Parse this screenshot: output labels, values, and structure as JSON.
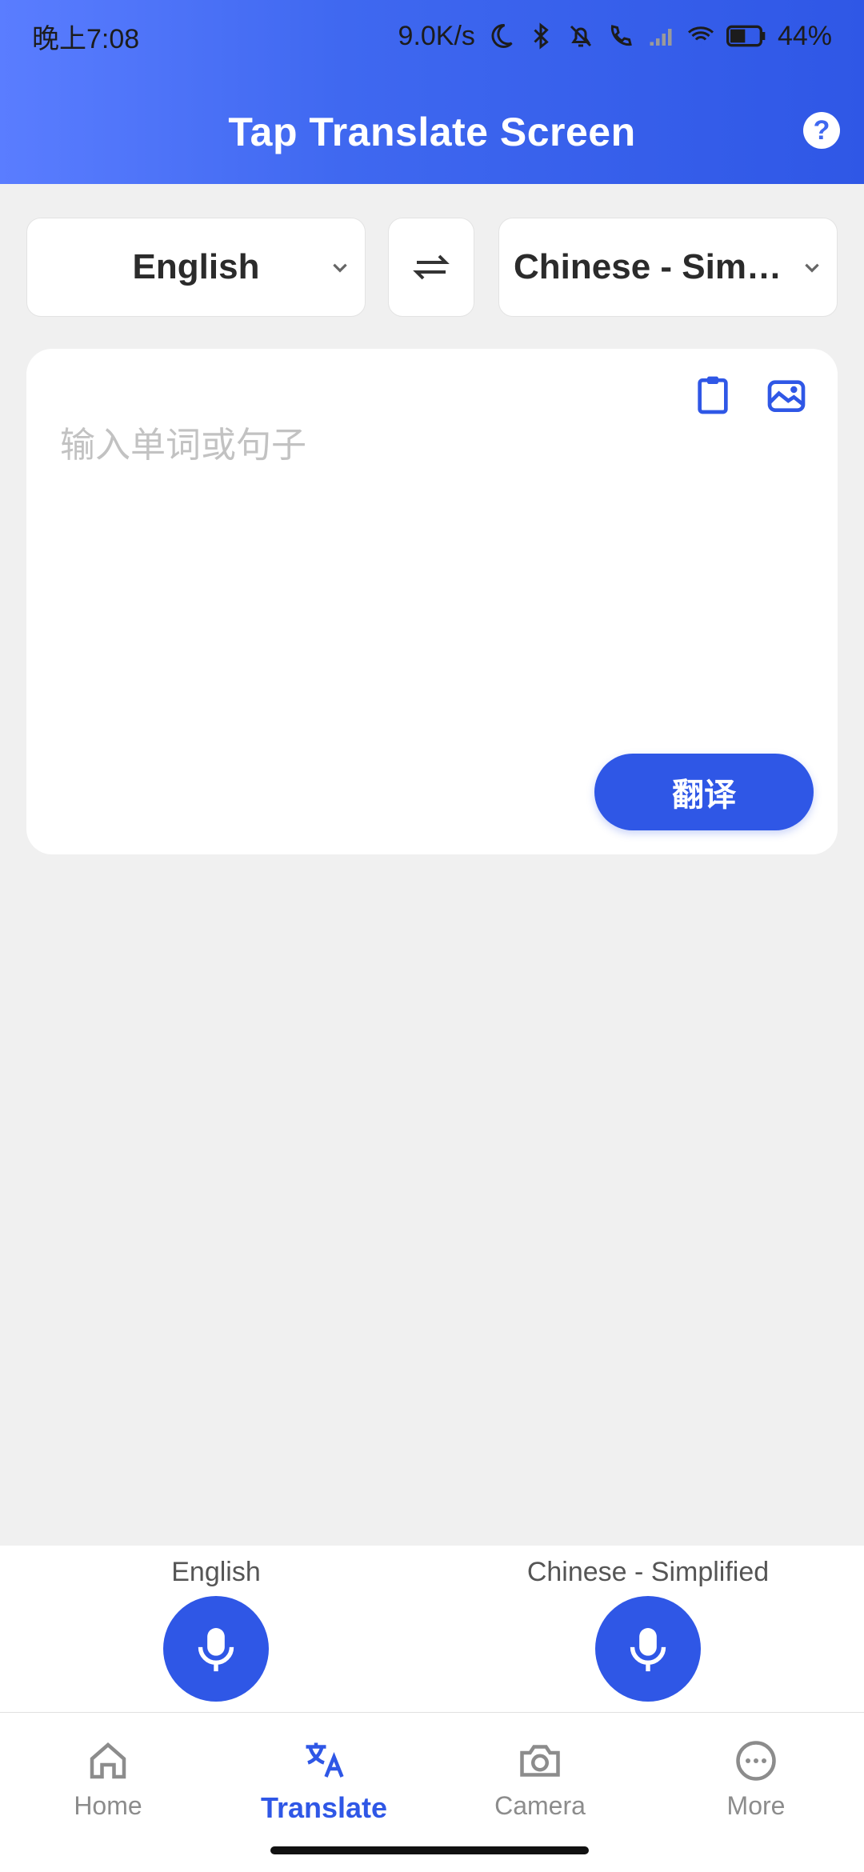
{
  "status_bar": {
    "time": "晚上7:08",
    "network_speed": "9.0K/s",
    "battery": "44%"
  },
  "header": {
    "title": "Tap Translate Screen",
    "help_symbol": "?"
  },
  "languages": {
    "source": "English",
    "target": "Chinese - Simpl..."
  },
  "input": {
    "placeholder": "输入单词或句子",
    "translate_label": "翻译"
  },
  "voice": {
    "left_label": "English",
    "right_label": "Chinese - Simplified"
  },
  "nav": {
    "items": [
      {
        "label": "Home"
      },
      {
        "label": "Translate"
      },
      {
        "label": "Camera"
      },
      {
        "label": "More"
      }
    ]
  },
  "icons": {
    "help": "help-icon",
    "swap": "swap-icon",
    "clipboard": "clipboard-icon",
    "image": "image-icon",
    "mic": "mic-icon",
    "home": "home-icon",
    "translate": "translate-icon",
    "camera": "camera-icon",
    "more": "more-icon"
  },
  "colors": {
    "accent": "#2f57e6",
    "header_gradient_start": "#5a7dff",
    "background": "#f0f0f0"
  }
}
